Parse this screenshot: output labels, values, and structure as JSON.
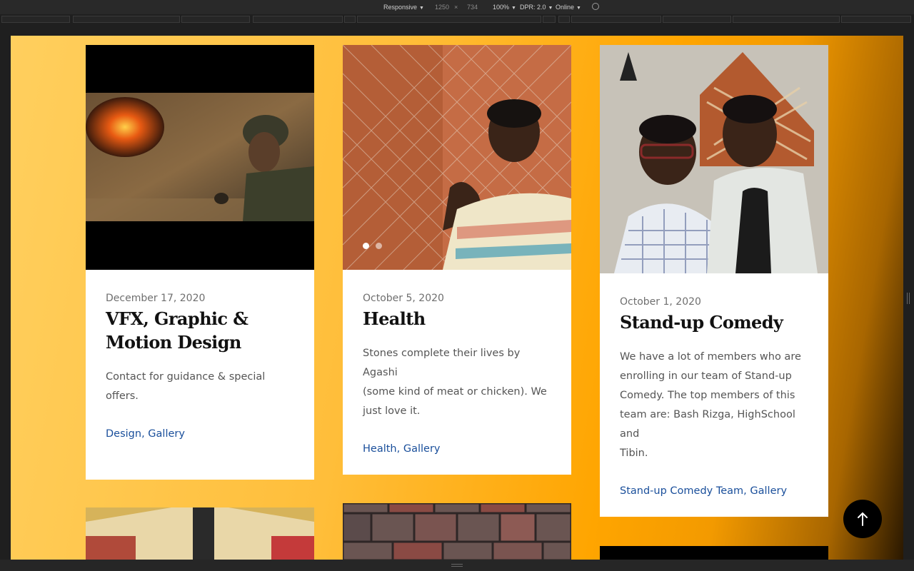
{
  "devtools": {
    "device": "Responsive",
    "width": "1250",
    "times": "×",
    "height": "734",
    "zoom": "100%",
    "dpr": "DPR: 2.0",
    "network": "Online"
  },
  "posts": [
    {
      "date": "December 17, 2020",
      "title_line1": "VFX, Graphic &",
      "title_line2": "Motion Design",
      "excerpt_line1": "Contact for guidance & special",
      "excerpt_line2": "offers.",
      "cat1": "Design",
      "cat2": "Gallery"
    },
    {
      "date": "October 5, 2020",
      "title_line1": "Health",
      "excerpt_line1": "Stones complete their lives by Agashi",
      "excerpt_line2": "(some kind of meat or chicken). We",
      "excerpt_line3": "just love it.",
      "cat1": "Health",
      "cat2": "Gallery"
    },
    {
      "date": "October 1, 2020",
      "title_line1": "Stand-up Comedy",
      "excerpt_line1": "We have a lot of members who are",
      "excerpt_line2": "enrolling in our team of Stand-up",
      "excerpt_line3": "Comedy. The top members of this",
      "excerpt_line4": "team are: Bash Rizga, HighSchool and",
      "excerpt_line5": "Tibin.",
      "cat1": "Stand-up Comedy Team",
      "cat2": "Gallery"
    }
  ],
  "slider": {
    "slides": 2,
    "active": 1
  },
  "separator": ", ",
  "colors": {
    "accent": "#ffa500",
    "link": "#1a4f9b",
    "title": "#111111"
  },
  "icons": {
    "back_to_top": "arrow-up-icon",
    "rotate": "rotate-icon"
  }
}
